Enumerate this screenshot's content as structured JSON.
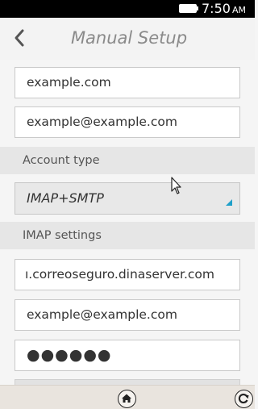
{
  "status": {
    "time": "7:50",
    "ampm": "AM"
  },
  "header": {
    "title": "Manual Setup",
    "back_icon": "back-chevron-icon"
  },
  "fields": {
    "domain": "example.com",
    "email": "example@example.com"
  },
  "account_type": {
    "section_label": "Account type",
    "selected": "IMAP+SMTP"
  },
  "imap": {
    "section_label": "IMAP settings",
    "server": "ı.correoseguro.dinaserver.com",
    "username": "example@example.com",
    "password_mask": "●●●●●●"
  },
  "bottom": {
    "home_icon": "home-icon",
    "refresh_icon": "refresh-icon"
  },
  "colors": {
    "accent": "#1fa0c9"
  }
}
